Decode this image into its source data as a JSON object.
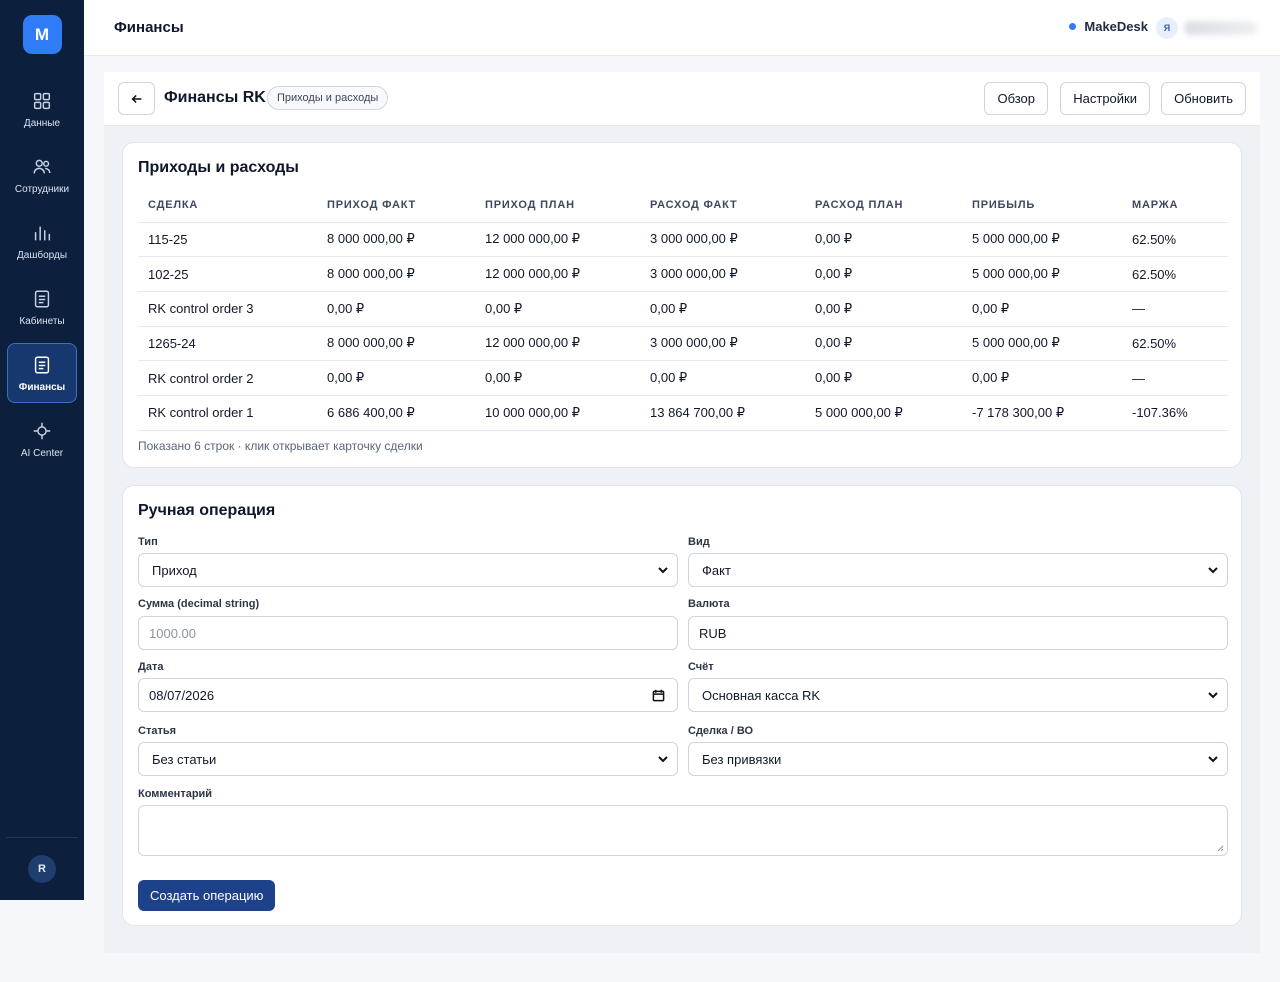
{
  "sidebar": {
    "logo": "M",
    "items": [
      {
        "label": "Данные",
        "icon": "grid-icon"
      },
      {
        "label": "Сотрудники",
        "icon": "users-icon"
      },
      {
        "label": "Дашборды",
        "icon": "bar-chart-icon"
      },
      {
        "label": "Кабинеты",
        "icon": "document-icon"
      },
      {
        "label": "Финансы",
        "icon": "finance-document-icon",
        "active": true
      },
      {
        "label": "AI Center",
        "icon": "crosshair-icon"
      }
    ],
    "user_initial": "R"
  },
  "topbar": {
    "title": "Финансы",
    "brand": "MakeDesk",
    "user_initial": "Я"
  },
  "header": {
    "title": "Финансы RK",
    "tag": "Приходы и расходы",
    "buttons": {
      "overview": "Обзор",
      "settings": "Настройки",
      "refresh": "Обновить"
    }
  },
  "table_card": {
    "title": "Приходы и расходы",
    "columns": [
      "СДЕЛКА",
      "ПРИХОД ФАКТ",
      "ПРИХОД ПЛАН",
      "РАСХОД ФАКТ",
      "РАСХОД ПЛАН",
      "ПРИБЫЛЬ",
      "МАРЖА"
    ],
    "rows": [
      [
        "115-25",
        "8 000 000,00 ₽",
        "12 000 000,00 ₽",
        "3 000 000,00 ₽",
        "0,00 ₽",
        "5 000 000,00 ₽",
        "62.50%"
      ],
      [
        "102-25",
        "8 000 000,00 ₽",
        "12 000 000,00 ₽",
        "3 000 000,00 ₽",
        "0,00 ₽",
        "5 000 000,00 ₽",
        "62.50%"
      ],
      [
        "RK control order 3",
        "0,00 ₽",
        "0,00 ₽",
        "0,00 ₽",
        "0,00 ₽",
        "0,00 ₽",
        "—"
      ],
      [
        "1265-24",
        "8 000 000,00 ₽",
        "12 000 000,00 ₽",
        "3 000 000,00 ₽",
        "0,00 ₽",
        "5 000 000,00 ₽",
        "62.50%"
      ],
      [
        "RK control order 2",
        "0,00 ₽",
        "0,00 ₽",
        "0,00 ₽",
        "0,00 ₽",
        "0,00 ₽",
        "—"
      ],
      [
        "RK control order 1",
        "6 686 400,00 ₽",
        "10 000 000,00 ₽",
        "13 864 700,00 ₽",
        "5 000 000,00 ₽",
        "-7 178 300,00 ₽",
        "-107.36%"
      ]
    ],
    "note": "Показано 6 строк · клик открывает карточку сделки"
  },
  "form": {
    "title": "Ручная операция",
    "type": {
      "label": "Тип",
      "value": "Приход"
    },
    "kind": {
      "label": "Вид",
      "value": "Факт"
    },
    "amount": {
      "label": "Сумма (decimal string)",
      "placeholder": "1000.00"
    },
    "currency": {
      "label": "Валюта",
      "value": "RUB"
    },
    "date": {
      "label": "Дата",
      "value": "08/07/2026"
    },
    "account": {
      "label": "Счёт",
      "value": "Основная касса RK"
    },
    "article": {
      "label": "Статья",
      "value": "Без статьи"
    },
    "deal": {
      "label": "Сделка / ВО",
      "value": "Без привязки"
    },
    "comment": {
      "label": "Комментарий",
      "value": ""
    },
    "submit": "Создать операцию"
  }
}
